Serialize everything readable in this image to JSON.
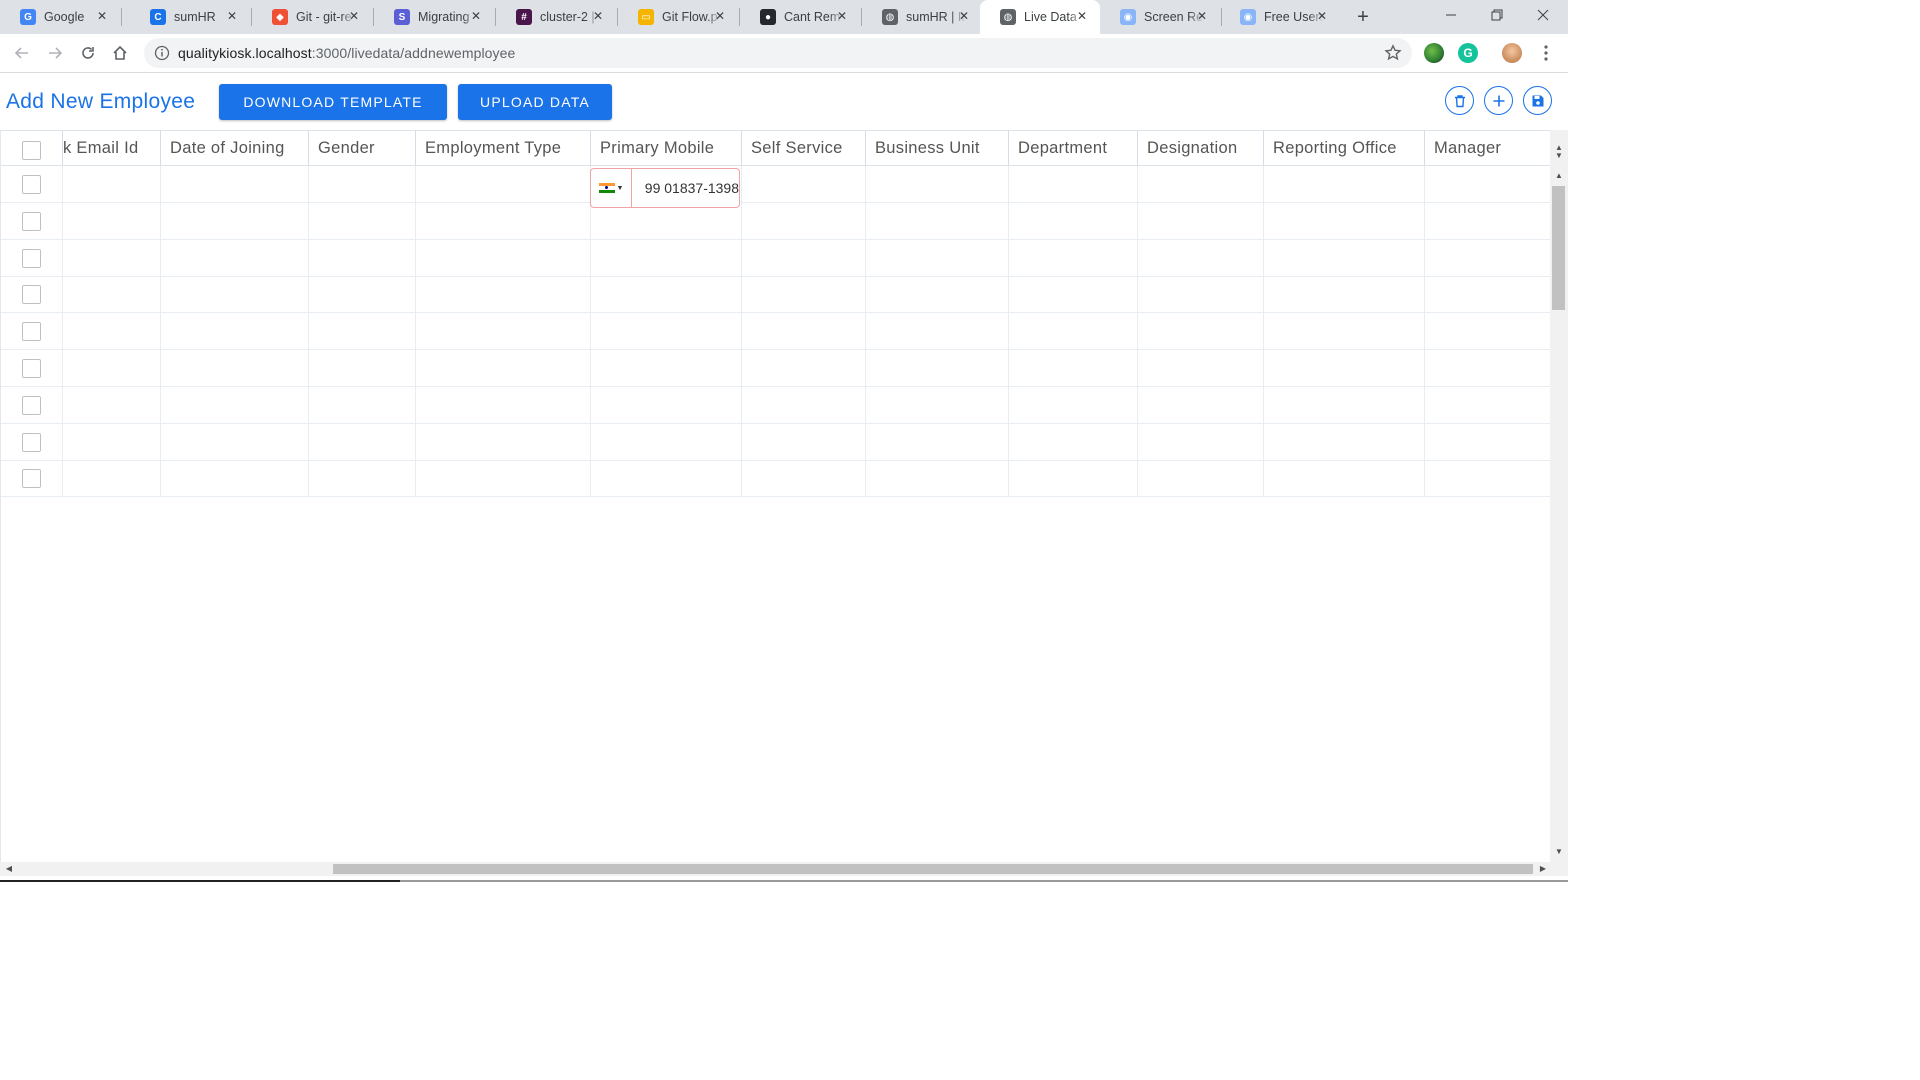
{
  "browser": {
    "tabs": [
      {
        "title": "Google",
        "icon": "google-icon",
        "color": "#4285f4",
        "glyph": "G",
        "active": false
      },
      {
        "title": "sumHR",
        "icon": "sumhr-icon",
        "color": "#1a73e8",
        "glyph": "C",
        "active": false
      },
      {
        "title": "Git - git-re",
        "icon": "git-icon",
        "color": "#f05033",
        "glyph": "◆",
        "active": false
      },
      {
        "title": "Migrating",
        "icon": "s-icon",
        "color": "#5a5fd6",
        "glyph": "S",
        "active": false
      },
      {
        "title": "cluster-2 |",
        "icon": "slack-icon",
        "color": "#4a154b",
        "glyph": "#",
        "active": false
      },
      {
        "title": "Git Flow.p",
        "icon": "slides-icon",
        "color": "#f4b400",
        "glyph": "▭",
        "active": false
      },
      {
        "title": "Cant Rem",
        "icon": "github-icon",
        "color": "#24292e",
        "glyph": "●",
        "active": false
      },
      {
        "title": "sumHR | It",
        "icon": "globe-icon",
        "color": "#5f6368",
        "glyph": "◍",
        "active": false
      },
      {
        "title": "Live Data",
        "icon": "globe-icon",
        "color": "#5f6368",
        "glyph": "◍",
        "active": true
      },
      {
        "title": "Screen Re",
        "icon": "record-icon",
        "color": "#8ab4f8",
        "glyph": "◉",
        "active": false
      },
      {
        "title": "Free Users",
        "icon": "record-icon",
        "color": "#8ab4f8",
        "glyph": "◉",
        "active": false
      }
    ],
    "url_host": "qualitykiosk.localhost",
    "url_path": ":3000/livedata/addnewemployee"
  },
  "page": {
    "title": "Add New Employee",
    "download_label": "DOWNLOAD TEMPLATE",
    "upload_label": "UPLOAD DATA"
  },
  "grid": {
    "columns": [
      "k Email Id",
      "Date of Joining",
      "Gender",
      "Employment Type",
      "Primary Mobile",
      "Self Service",
      "Business Unit",
      "Department",
      "Designation",
      "Reporting Office",
      "Manager"
    ],
    "row_count": 9,
    "editing_cell": {
      "column": "Primary Mobile",
      "country_flag": "india-flag-icon",
      "value": "99 01837-1398"
    }
  },
  "colors": {
    "accent": "#1a73e8",
    "error_border": "#f0a3a8"
  }
}
